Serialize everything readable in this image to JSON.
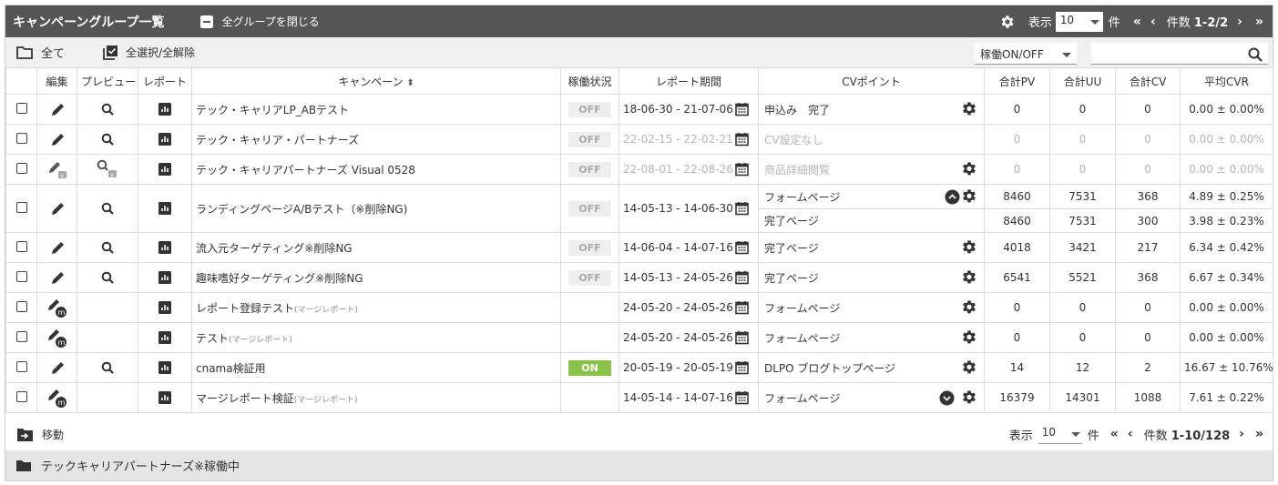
{
  "header": {
    "title": "キャンペーングループ一覧",
    "collapse_label": "全グループを閉じる",
    "display_label": "表示",
    "per_page": "10",
    "unit": "件",
    "first": "«",
    "prev": "‹",
    "count_label": "件数",
    "count_value": "1-2/2",
    "next": "›",
    "last": "»"
  },
  "toolbar": {
    "all_label": "全て",
    "select_all_label": "全選択/全解除",
    "status_filter": "稼働ON/OFF",
    "search_value": ""
  },
  "columns": [
    "編集",
    "プレビュー",
    "レポート",
    "キャンペーン",
    "稼働状況",
    "レポート期間",
    "CVポイント",
    "合計PV",
    "合計UU",
    "合計CV",
    "平均CVR"
  ],
  "rows": [
    {
      "name": "テック・キャリアLP_ABテスト",
      "suffix": "",
      "status": "OFF",
      "period": "18-06-30 - 21-07-06",
      "period_gray": false,
      "edit": "pencil",
      "preview": "search",
      "cv": [
        {
          "point": "申込み　完了",
          "pv": "0",
          "uu": "0",
          "cv": "0",
          "cvr": "0.00 ± 0.00%"
        }
      ],
      "gray": false,
      "gear": true
    },
    {
      "name": "テック・キャリア・パートナーズ",
      "suffix": "",
      "status": "OFF",
      "period": "22-02-15 - 22-02-21",
      "period_gray": true,
      "edit": "pencil",
      "preview": "search",
      "cv": [
        {
          "point": "CV設定なし",
          "pv": "0",
          "uu": "0",
          "cv": "0",
          "cvr": "0.00 ± 0.00%"
        }
      ],
      "gray": true,
      "gear": false
    },
    {
      "name": "テック・キャリアパートナーズ Visual 0528",
      "suffix": "",
      "status": "OFF",
      "period": "22-08-01 - 22-08-26",
      "period_gray": true,
      "edit": "pencil-v",
      "preview": "search-v",
      "cv": [
        {
          "point": "商品詳細閲覧",
          "pv": "0",
          "uu": "0",
          "cv": "0",
          "cvr": "0.00 ± 0.00%"
        }
      ],
      "gray": true,
      "gear": true
    },
    {
      "name": "ランディングページA/Bテスト（※削除NG)",
      "suffix": "",
      "status": "OFF",
      "period": "14-05-13 - 14-06-30",
      "period_gray": false,
      "edit": "pencil",
      "preview": "search",
      "cv": [
        {
          "point": "フォームページ",
          "pv": "8460",
          "uu": "7531",
          "cv": "368",
          "cvr": "4.89 ± 0.25%"
        },
        {
          "point": "完了ページ",
          "pv": "8460",
          "uu": "7531",
          "cv": "300",
          "cvr": "3.98 ± 0.23%"
        }
      ],
      "gray": false,
      "gear": true,
      "expand": "up"
    },
    {
      "name": "流入元ターゲティング※削除NG",
      "suffix": "",
      "status": "OFF",
      "period": "14-06-04 - 14-07-16",
      "period_gray": false,
      "edit": "pencil",
      "preview": "search",
      "cv": [
        {
          "point": "完了ページ",
          "pv": "4018",
          "uu": "3421",
          "cv": "217",
          "cvr": "6.34 ± 0.42%"
        }
      ],
      "gray": false,
      "gear": true
    },
    {
      "name": "趣味嗜好ターゲティング※削除NG",
      "suffix": "",
      "status": "OFF",
      "period": "14-05-13 - 24-05-26",
      "period_gray": false,
      "edit": "pencil",
      "preview": "search",
      "cv": [
        {
          "point": "完了ページ",
          "pv": "6541",
          "uu": "5521",
          "cv": "368",
          "cvr": "6.67 ± 0.34%"
        }
      ],
      "gray": false,
      "gear": true
    },
    {
      "name": "レポート登録テスト",
      "suffix": "(マージレポート)",
      "status": "",
      "period": "24-05-20 - 24-05-26",
      "period_gray": false,
      "edit": "pencil-m",
      "preview": "",
      "cv": [
        {
          "point": "フォームページ",
          "pv": "0",
          "uu": "0",
          "cv": "0",
          "cvr": "0.00 ± 0.00%"
        }
      ],
      "gray": false,
      "gear": true
    },
    {
      "name": "テスト",
      "suffix": "(マージレポート)",
      "status": "",
      "period": "24-05-20 - 24-05-26",
      "period_gray": false,
      "edit": "pencil-m",
      "preview": "",
      "cv": [
        {
          "point": "フォームページ",
          "pv": "0",
          "uu": "0",
          "cv": "0",
          "cvr": "0.00 ± 0.00%"
        }
      ],
      "gray": false,
      "gear": true
    },
    {
      "name": "cnama検証用",
      "suffix": "",
      "status": "ON",
      "period": "20-05-19 - 20-05-19",
      "period_gray": false,
      "edit": "pencil",
      "preview": "search",
      "cv": [
        {
          "point": "DLPO ブログトップページ",
          "pv": "14",
          "uu": "12",
          "cv": "2",
          "cvr": "16.67 ± 10.76%"
        }
      ],
      "gray": false,
      "gear": true
    },
    {
      "name": "マージレポート検証",
      "suffix": "(マージレポート)",
      "status": "",
      "period": "14-05-14 - 14-07-16",
      "period_gray": false,
      "edit": "pencil-m",
      "preview": "",
      "cv": [
        {
          "point": "フォームページ",
          "pv": "16379",
          "uu": "14301",
          "cv": "1088",
          "cvr": "7.61 ± 0.22%"
        }
      ],
      "gray": false,
      "gear": true,
      "expand": "down"
    }
  ],
  "footer": {
    "move_label": "移動",
    "display_label": "表示",
    "per_page": "10",
    "unit": "件",
    "first": "«",
    "prev": "‹",
    "count_label": "件数",
    "count_value": "1-10/128",
    "next": "›",
    "last": "»"
  },
  "group": {
    "name": "テックキャリアパートナーズ※稼働中"
  }
}
